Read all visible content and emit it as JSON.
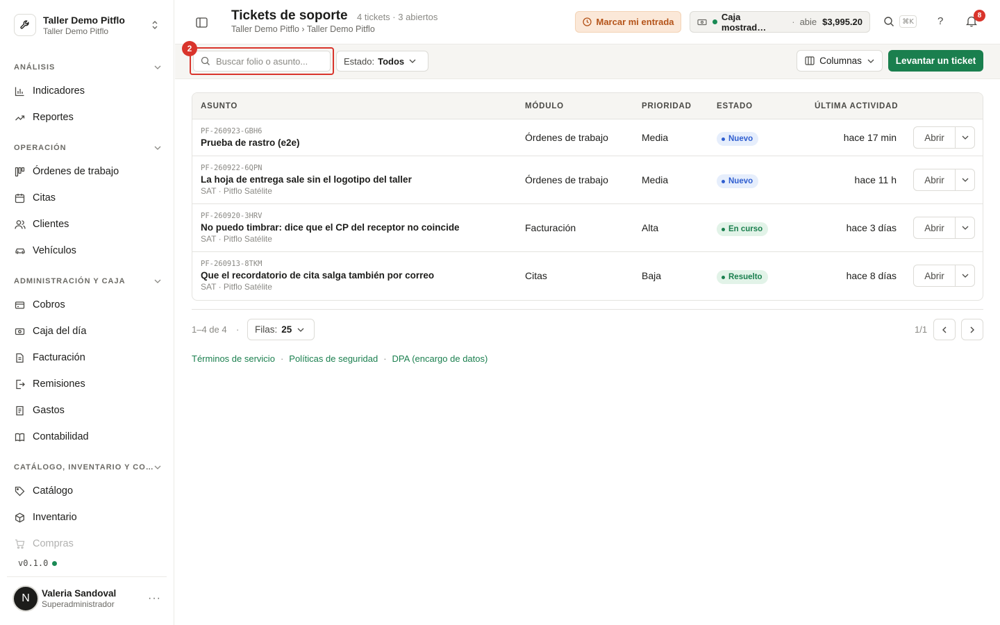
{
  "org": {
    "name": "Taller Demo Pitflo",
    "subtitle": "Taller Demo Pitflo"
  },
  "sidebar": {
    "sections": [
      {
        "title": "ANÁLISIS",
        "items": [
          {
            "label": "Indicadores",
            "icon": "bar-chart-icon"
          },
          {
            "label": "Reportes",
            "icon": "trend-icon"
          }
        ]
      },
      {
        "title": "OPERACIÓN",
        "items": [
          {
            "label": "Órdenes de trabajo",
            "icon": "kanban-icon"
          },
          {
            "label": "Citas",
            "icon": "calendar-icon"
          },
          {
            "label": "Clientes",
            "icon": "users-icon"
          },
          {
            "label": "Vehículos",
            "icon": "car-icon"
          }
        ]
      },
      {
        "title": "ADMINISTRACIÓN Y CAJA",
        "items": [
          {
            "label": "Cobros",
            "icon": "credit-card-icon"
          },
          {
            "label": "Caja del día",
            "icon": "cash-icon"
          },
          {
            "label": "Facturación",
            "icon": "invoice-icon"
          },
          {
            "label": "Remisiones",
            "icon": "file-export-icon"
          },
          {
            "label": "Gastos",
            "icon": "receipt-icon"
          },
          {
            "label": "Contabilidad",
            "icon": "book-icon"
          }
        ]
      },
      {
        "title": "CATÁLOGO, INVENTARIO Y CO…",
        "items": [
          {
            "label": "Catálogo",
            "icon": "tag-icon"
          },
          {
            "label": "Inventario",
            "icon": "box-icon"
          },
          {
            "label": "Compras",
            "icon": "cart-icon"
          }
        ]
      }
    ],
    "version": "v0.1.0"
  },
  "user": {
    "initial": "N",
    "name": "Valeria Sandoval",
    "role": "Superadministrador",
    "more": "···"
  },
  "header": {
    "title": "Tickets de soporte",
    "meta": "4 tickets · 3 abiertos",
    "breadcrumb": "Taller Demo Pitflo › Taller Demo Pitflo",
    "clock_in_label": "Marcar mi entrada",
    "register_name": "Caja mostrad…",
    "register_sep": "·",
    "register_status": "abie",
    "register_amount": "$3,995.20",
    "shortcut": "⌘K",
    "help": "?",
    "notifications": "8"
  },
  "toolbar": {
    "search_placeholder": "Buscar folio o asunto...",
    "step": "2",
    "status_filter_label": "Estado:",
    "status_filter_value": "Todos",
    "columns_label": "Columnas",
    "new_ticket_label": "Levantar un ticket"
  },
  "table": {
    "headers": {
      "subject": "ASUNTO",
      "module": "MÓDULO",
      "priority": "PRIORIDAD",
      "status": "ESTADO",
      "activity": "ÚLTIMA ACTIVIDAD"
    },
    "open_label": "Abrir",
    "rows": [
      {
        "folio": "PF-260923-GBH6",
        "subject": "Prueba de rastro (e2e)",
        "origin": "",
        "module": "Órdenes de trabajo",
        "priority": "Media",
        "status": "Nuevo",
        "status_tone": "blue",
        "activity": "hace 17 min"
      },
      {
        "folio": "PF-260922-6QPN",
        "subject": "La hoja de entrega sale sin el logotipo del taller",
        "origin": "SAT · Pitflo Satélite",
        "module": "Órdenes de trabajo",
        "priority": "Media",
        "status": "Nuevo",
        "status_tone": "blue",
        "activity": "hace 11 h"
      },
      {
        "folio": "PF-260920-3HRV",
        "subject": "No puedo timbrar: dice que el CP del receptor no coincide",
        "origin": "SAT · Pitflo Satélite",
        "module": "Facturación",
        "priority": "Alta",
        "status": "En curso",
        "status_tone": "green",
        "activity": "hace 3 días"
      },
      {
        "folio": "PF-260913-8TKM",
        "subject": "Que el recordatorio de cita salga también por correo",
        "origin": "SAT · Pitflo Satélite",
        "module": "Citas",
        "priority": "Baja",
        "status": "Resuelto",
        "status_tone": "green",
        "activity": "hace 8 días"
      }
    ]
  },
  "pagination": {
    "range": "1–4 de 4",
    "dot": "·",
    "rows_label": "Filas:",
    "rows_value": "25",
    "pages": "1/1"
  },
  "legal": {
    "terms": "Términos de servicio",
    "security": "Políticas de seguridad",
    "dpa": "DPA (encargo de datos)",
    "sep": "·"
  },
  "colors": {
    "accent": "#1a7f4e",
    "danger": "#d9342b",
    "warning_bg": "#fbe8d8"
  }
}
